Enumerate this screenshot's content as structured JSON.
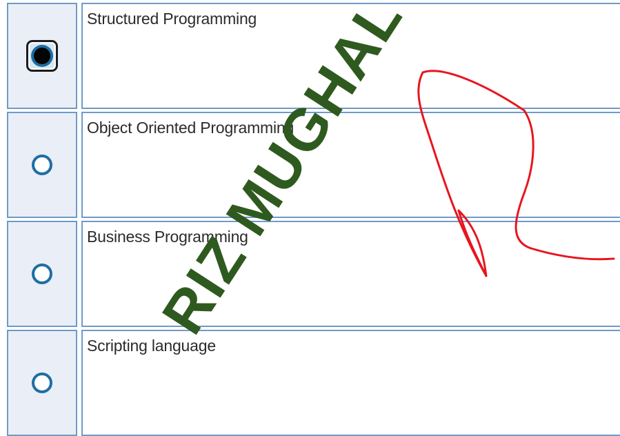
{
  "question": {
    "options": [
      {
        "label": "Structured Programming",
        "selected": true
      },
      {
        "label": "Object Oriented Programming",
        "selected": false
      },
      {
        "label": "Business Programming",
        "selected": false
      },
      {
        "label": "Scripting language",
        "selected": false
      }
    ]
  },
  "watermark": {
    "text": "RIZ MUGHAL"
  },
  "colors": {
    "cell_border": "#6f9ac6",
    "radio_cell_bg": "#e9eef7",
    "radio_ring": "#1f6ea3",
    "watermark": "#2f5a1f",
    "signature_ink": "#e8141e"
  }
}
